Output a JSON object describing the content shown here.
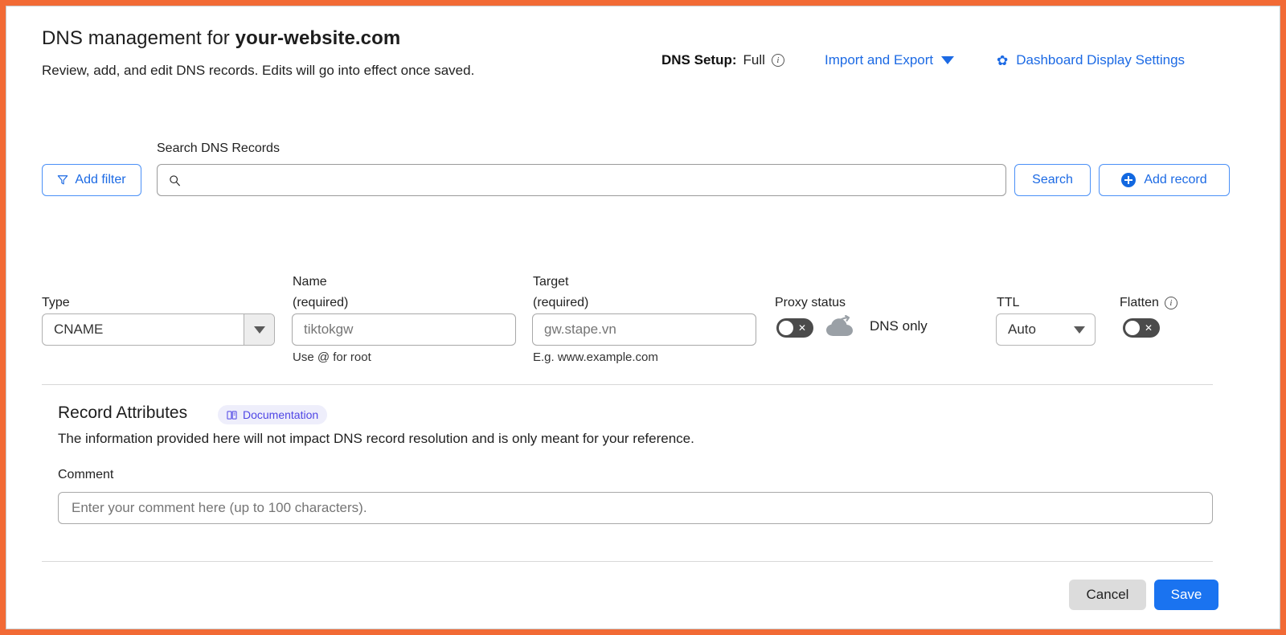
{
  "header": {
    "title_prefix": "DNS management for ",
    "domain": "your-website.com",
    "subtitle": "Review, add, and edit DNS records. Edits will go into effect once saved.",
    "dns_setup_label": "DNS Setup:",
    "dns_setup_value": "Full",
    "info_glyph": "i",
    "import_export_label": "Import and Export",
    "dashboard_settings_label": "Dashboard Display Settings",
    "gear_glyph": "✿"
  },
  "search": {
    "add_filter_label": "Add filter",
    "label": "Search DNS Records",
    "value": "",
    "placeholder": "",
    "search_button_label": "Search",
    "add_record_label": "Add record"
  },
  "record": {
    "type": {
      "label": "Type",
      "value": "CNAME"
    },
    "name": {
      "label_line1": "Name",
      "label_line2": "(required)",
      "value": "tiktokgw",
      "placeholder": "tiktokgw",
      "hint": "Use @ for root"
    },
    "target": {
      "label_line1": "Target",
      "label_line2": "(required)",
      "value": "gw.stape.vn",
      "placeholder": "gw.stape.vn",
      "hint": "E.g. www.example.com"
    },
    "proxy": {
      "label": "Proxy status",
      "state": "off",
      "toggle_glyph": "✕",
      "status_text": "DNS only"
    },
    "ttl": {
      "label": "TTL",
      "value": "Auto"
    },
    "flatten": {
      "label": "Flatten",
      "state": "off",
      "toggle_glyph": "✕",
      "info_glyph": "i"
    }
  },
  "attributes": {
    "section_title": "Record Attributes",
    "documentation_badge": "Documentation",
    "description": "The information provided here will not impact DNS record resolution and is only meant for your reference.",
    "comment_label": "Comment",
    "comment_value": "",
    "comment_placeholder": "Enter your comment here (up to 100 characters)."
  },
  "footer": {
    "cancel_label": "Cancel",
    "save_label": "Save"
  },
  "colors": {
    "accent_blue": "#1c6ae4",
    "save_blue": "#1a73f0",
    "frame_orange": "#f26a35",
    "badge_indigo": "#4f46e5",
    "badge_bg": "#eeeefb"
  }
}
